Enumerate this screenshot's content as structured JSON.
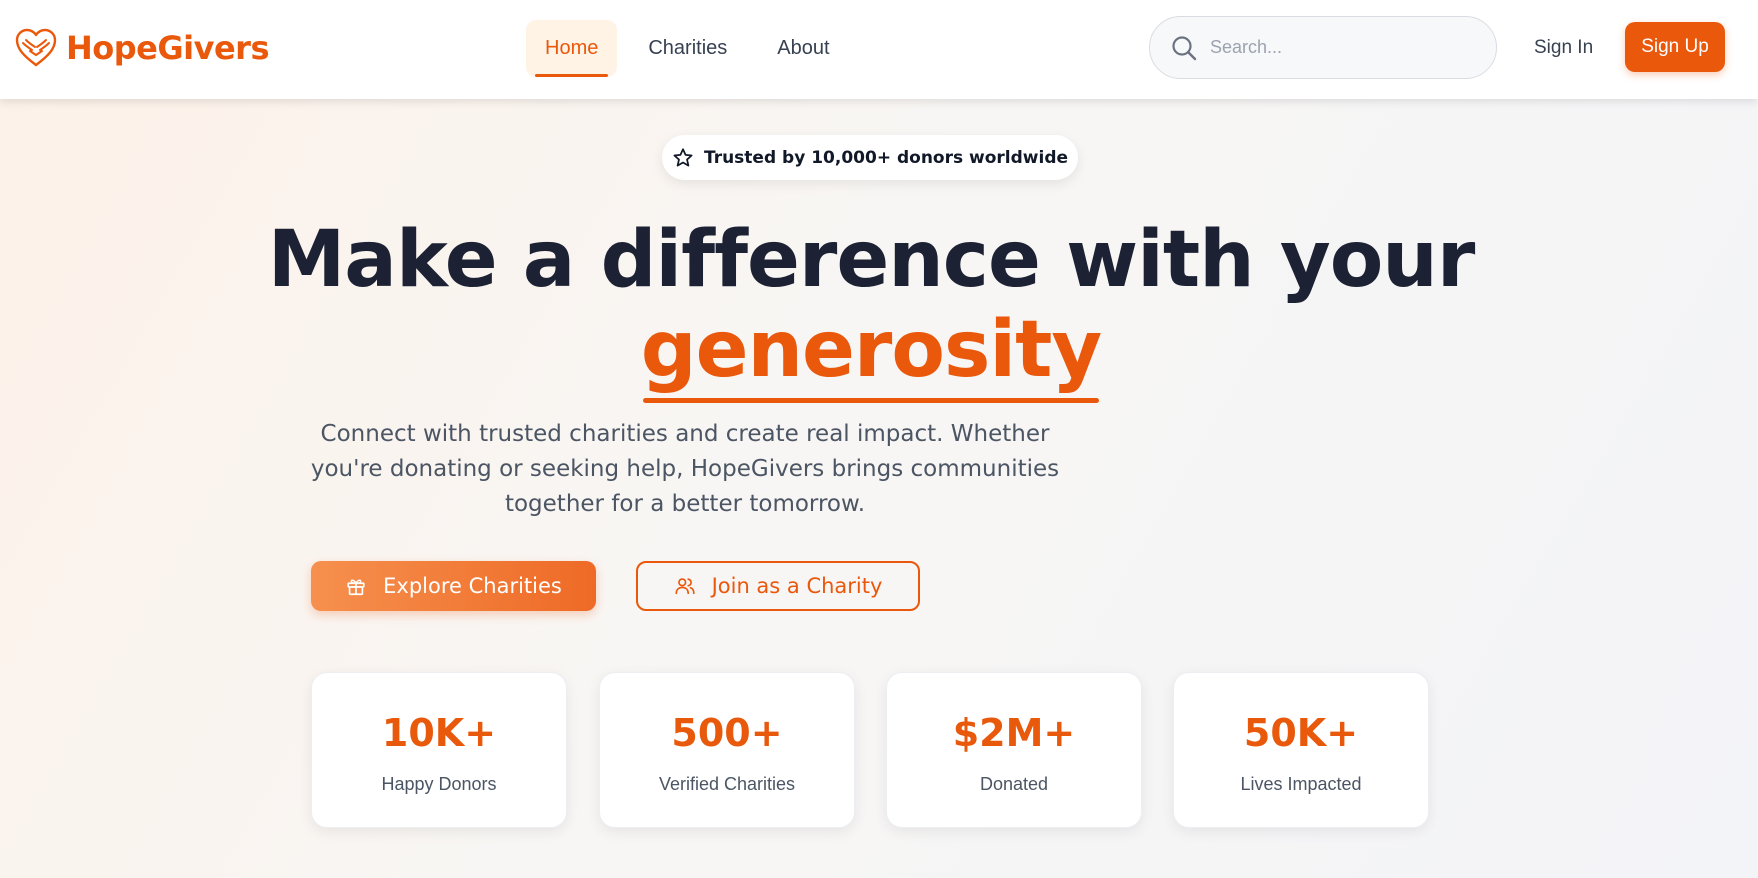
{
  "brand": {
    "name": "HopeGivers",
    "logo_icon": "heart-hands-icon",
    "accent_color": "#ea580c"
  },
  "nav": {
    "items": [
      {
        "label": "Home",
        "active": true
      },
      {
        "label": "Charities",
        "active": false
      },
      {
        "label": "About",
        "active": false
      }
    ]
  },
  "search": {
    "placeholder": "Search...",
    "value": "",
    "icon": "search-icon"
  },
  "auth": {
    "sign_in": "Sign In",
    "sign_up": "Sign Up"
  },
  "hero": {
    "badge": {
      "icon": "star-icon",
      "text": "Trusted by 10,000+ donors worldwide"
    },
    "headline_line1": "Make a difference with your",
    "headline_highlight": "generosity",
    "subtitle_lines": [
      "Connect with trusted charities and create real impact. Whether",
      "you're donating or seeking help, HopeGivers brings communities",
      "together for a better tomorrow."
    ],
    "primary_cta": {
      "label": "Explore Charities",
      "icon": "gift-icon"
    },
    "secondary_cta": {
      "label": "Join as a Charity",
      "icon": "users-icon"
    }
  },
  "stats": [
    {
      "value": "10K+",
      "label": "Happy Donors"
    },
    {
      "value": "500+",
      "label": "Verified Charities"
    },
    {
      "value": "$2M+",
      "label": "Donated"
    },
    {
      "value": "50K+",
      "label": "Lives Impacted"
    }
  ]
}
